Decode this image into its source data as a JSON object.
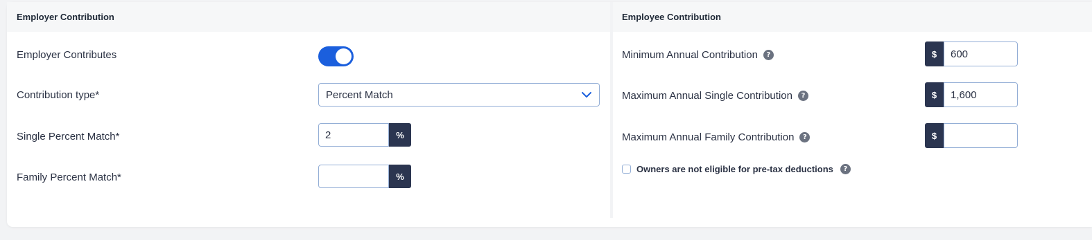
{
  "employer": {
    "header": "Employer Contribution",
    "contributes_label": "Employer Contributes",
    "contributes_on": true,
    "type_label": "Contribution type*",
    "type_value": "Percent Match",
    "single_label": "Single Percent Match*",
    "single_value": "2",
    "family_label": "Family Percent Match*",
    "family_value": "",
    "percent_suffix": "%"
  },
  "employee": {
    "header": "Employee Contribution",
    "min_label": "Minimum Annual Contribution",
    "min_value": "600",
    "max_single_label": "Maximum Annual Single Contribution",
    "max_single_value": "1,600",
    "max_family_label": "Maximum Annual Family Contribution",
    "max_family_value": "",
    "currency_prefix": "$",
    "owners_label": "Owners are not eligible for pre-tax deductions",
    "owners_checked": false
  },
  "icons": {
    "help": "?",
    "chevron": "chevron-down-icon"
  },
  "colors": {
    "accent": "#1b5fdd",
    "addon_bg": "#2b3550",
    "input_border": "#93aed6"
  }
}
